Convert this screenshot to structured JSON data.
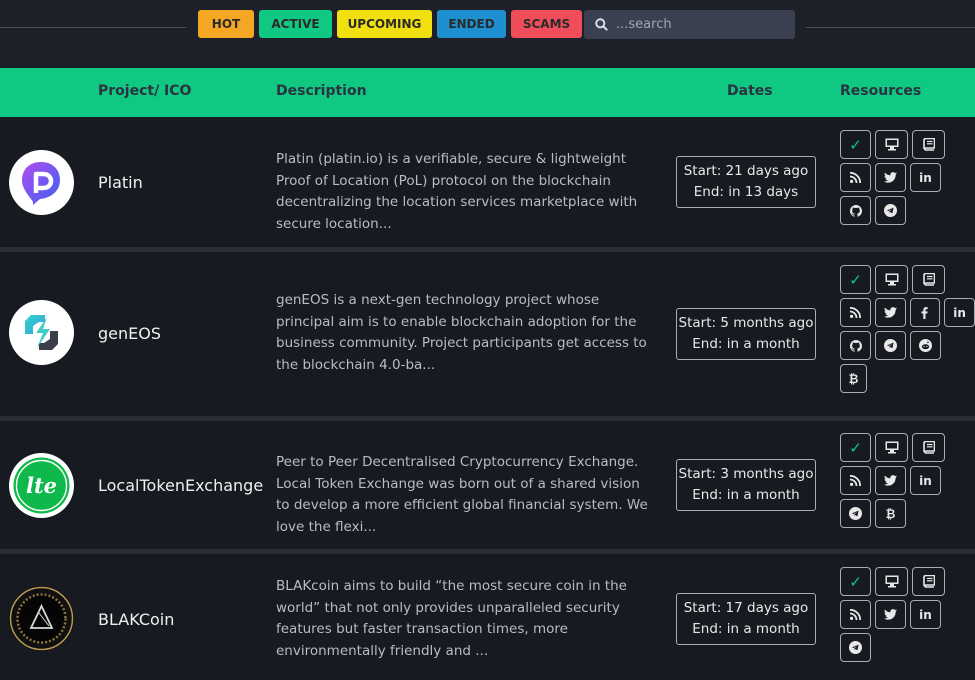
{
  "filters": [
    {
      "label": "HOT",
      "color": "#f5a623"
    },
    {
      "label": "ACTIVE",
      "color": "#0fc882"
    },
    {
      "label": "UPCOMING",
      "color": "#f0e010"
    },
    {
      "label": "ENDED",
      "color": "#1e90cf"
    },
    {
      "label": "SCAMS",
      "color": "#f04d5a"
    }
  ],
  "search": {
    "placeholder": "...search"
  },
  "table": {
    "headers": {
      "project": "Project/ ICO",
      "description": "Description",
      "dates": "Dates",
      "resources": "Resources"
    },
    "rows": [
      {
        "name": "Platin",
        "description": "Platin (platin.io) is a verifiable, secure & lightweight Proof of Location (PoL) protocol on the blockchain decentralizing the location services marketplace with secure location...",
        "start": "Start: 21 days ago",
        "end": "End: in 13 days",
        "resources": [
          [
            "check-icon",
            "desktop-icon",
            "book-icon"
          ],
          [
            "rss-icon",
            "twitter-icon",
            "linkedin-icon"
          ],
          [
            "github-icon",
            "telegram-icon"
          ]
        ]
      },
      {
        "name": "genEOS",
        "description": "genEOS is a next-gen technology project whose principal aim is to enable blockchain adoption for the business community. Project participants get access to the blockchain 4.0-ba...",
        "start": "Start: 5 months ago",
        "end": "End: in a month",
        "resources": [
          [
            "check-icon",
            "desktop-icon",
            "book-icon"
          ],
          [
            "rss-icon",
            "twitter-icon",
            "facebook-icon",
            "linkedin-icon"
          ],
          [
            "github-icon",
            "telegram-icon",
            "reddit-icon"
          ],
          [
            "bitcoin-icon"
          ]
        ]
      },
      {
        "name": "LocalTokenExchange",
        "logo_text": "lte",
        "description": "Peer to Peer Decentralised Cryptocurrency Exchange. Local Token Exchange was born out of a shared vision to develop a more efficient global financial system. We love the flexi...",
        "start": "Start: 3 months ago",
        "end": "End: in a month",
        "resources": [
          [
            "check-icon",
            "desktop-icon",
            "book-icon"
          ],
          [
            "rss-icon",
            "twitter-icon",
            "linkedin-icon"
          ],
          [
            "telegram-icon",
            "bitcoin-icon"
          ]
        ]
      },
      {
        "name": "BLAKCoin",
        "description": "BLAKcoin aims to build “the most secure coin in the world” that not only provides unparalleled security features but faster transaction times, more environmentally friendly and ...",
        "start": "Start: 17 days ago",
        "end": "End: in a month",
        "resources": [
          [
            "check-icon",
            "desktop-icon",
            "book-icon"
          ],
          [
            "rss-icon",
            "twitter-icon",
            "linkedin-icon"
          ],
          [
            "telegram-icon"
          ]
        ]
      }
    ]
  }
}
